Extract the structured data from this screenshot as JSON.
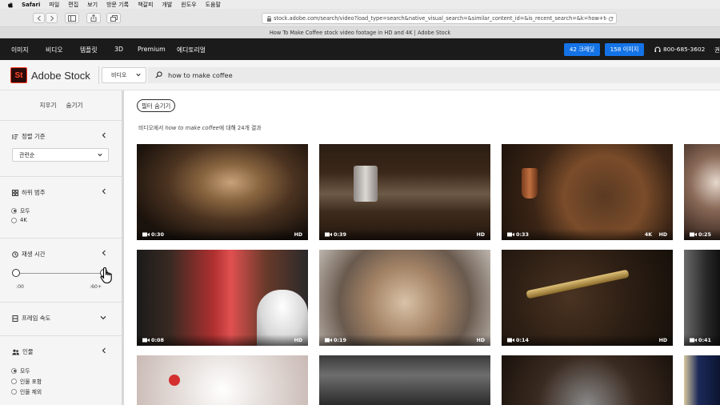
{
  "menubar": {
    "app": "Safari",
    "items": [
      "파일",
      "편집",
      "보기",
      "방문 기록",
      "책갈피",
      "개발",
      "윈도우",
      "도움말"
    ]
  },
  "browser": {
    "url": "stock.adobe.com/search/video?load_type=search&native_visual_search=&similar_content_id=&is_recent_search=&k=how+to+",
    "tab_title": "How To Make Coffee stock video footage in HD and 4K | Adobe Stock"
  },
  "topnav": {
    "items": [
      "이미지",
      "비디오",
      "템플릿",
      "3D",
      "Premium",
      "에디토리얼"
    ],
    "credits_label": "42 크레딧",
    "images_label": "158 이미지",
    "phone": "800-685-3602",
    "account_partial": "권"
  },
  "header": {
    "logo_mark": "St",
    "logo_text": "Adobe Stock",
    "type_select": "비디오",
    "search_query": "how to make coffee"
  },
  "sidebar": {
    "clear": "지우기",
    "hide": "숨기기",
    "sort": {
      "title": "정렬 기준",
      "value": "관련순"
    },
    "subcategory": {
      "title": "하위 범주",
      "options": [
        "모두",
        "4K"
      ],
      "selected": 0
    },
    "duration": {
      "title": "재생 시간",
      "min_label": ":00",
      "max_label": ":60+"
    },
    "framerate": {
      "title": "프레임 속도"
    },
    "people": {
      "title": "인물",
      "options": [
        "모두",
        "인물 포함",
        "인물 제외"
      ],
      "selected": 0
    }
  },
  "main": {
    "filter_toggle": "필터 숨기기",
    "result_prefix": "비디오에서 ",
    "result_query": "how to make coffee",
    "result_suffix": "에 대해 24개 결과",
    "videos": [
      {
        "duration": "0:30",
        "quality": "HD"
      },
      {
        "duration": "0:39",
        "quality": "HD"
      },
      {
        "duration": "0:33",
        "quality": "HD",
        "quality_extra": "4K"
      },
      {
        "duration": "0:25",
        "quality": ""
      },
      {
        "duration": "0:08",
        "quality": "HD"
      },
      {
        "duration": "0:19",
        "quality": "HD"
      },
      {
        "duration": "0:14",
        "quality": "HD"
      },
      {
        "duration": "0:41",
        "quality": ""
      },
      {
        "duration": "",
        "quality": ""
      },
      {
        "duration": "",
        "quality": ""
      },
      {
        "duration": "",
        "quality": ""
      },
      {
        "duration": "",
        "quality": ""
      }
    ]
  },
  "colors": {
    "accent": "#1473e6",
    "nav_bg": "#1b1b1b",
    "logo_red": "#ff3b1f"
  }
}
